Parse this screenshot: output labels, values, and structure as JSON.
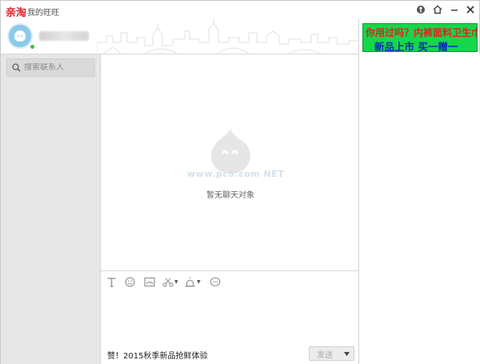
{
  "titlebar": {
    "logo": "亲淘",
    "title": "我的旺旺",
    "controls": [
      "help-icon",
      "home-icon",
      "minimize-icon",
      "close-icon"
    ]
  },
  "profile": {
    "status": "online",
    "status_color": "#3dbb3d"
  },
  "ad": {
    "line1": "你用过吗？内裤面料卫生巾",
    "line2": "新品上市  买一赠一",
    "bg_color": "#16d64b",
    "line1_color": "#e62020",
    "line2_color": "#0b2bb8"
  },
  "contacts": {
    "search_placeholder": "搜索联系人"
  },
  "chat": {
    "empty_text": "暂无聊天对象",
    "watermark": "www.pc6.com NET"
  },
  "toolbar": {
    "tools": [
      "text-format-icon",
      "emoji-icon",
      "image-icon",
      "scissors-icon",
      "alert-icon",
      "more-icon"
    ]
  },
  "footer": {
    "promo": "赞！2015秋季新品抢鲜体验",
    "send_label": "发送"
  },
  "colors": {
    "sidebar_bg": "#e7e7e7",
    "brand_red": "#e0232b",
    "avatar_bg": "#8cc9ea"
  }
}
